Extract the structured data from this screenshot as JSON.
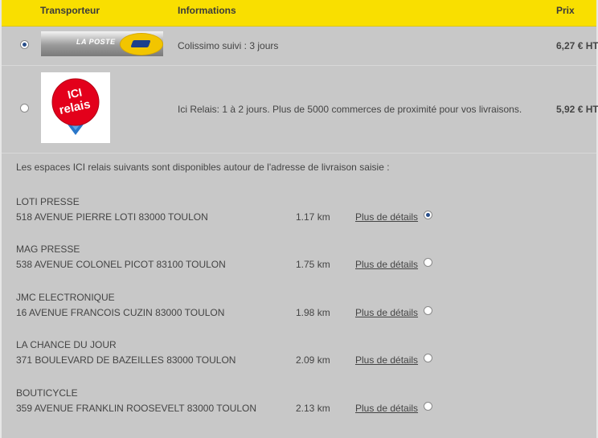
{
  "header": {
    "col_carrier": "Transporteur",
    "col_info": "Informations",
    "col_price": "Prix"
  },
  "carriers": [
    {
      "logo_text": "LA POSTE",
      "logo": "la-poste-logo",
      "info": "Colissimo suivi : 3 jours",
      "price": "6,27 € HT",
      "selected": true
    },
    {
      "logo_text": "ICI relais",
      "logo": "ici-relais-logo",
      "info": "Ici Relais: 1 à 2 jours. Plus de 5000 commerces de proximité pour vos livraisons.",
      "price": "5,92 € HT",
      "selected": false
    }
  ],
  "relais": {
    "intro": "Les espaces ICI relais suivants sont disponibles autour de l'adresse de livraison saisie :",
    "details_label": "Plus de détails",
    "items": [
      {
        "name": "LOTI PRESSE",
        "address": "518 AVENUE PIERRE LOTI 83000 TOULON",
        "distance": "1.17 km",
        "selected": true
      },
      {
        "name": "MAG PRESSE",
        "address": "538 AVENUE COLONEL PICOT 83100 TOULON",
        "distance": "1.75 km",
        "selected": false
      },
      {
        "name": "JMC ELECTRONIQUE",
        "address": "16 AVENUE FRANCOIS CUZIN 83000 TOULON",
        "distance": "1.98 km",
        "selected": false
      },
      {
        "name": "LA CHANCE DU JOUR",
        "address": "371 BOULEVARD DE BAZEILLES 83000 TOULON",
        "distance": "2.09 km",
        "selected": false
      },
      {
        "name": "BOUTICYCLE",
        "address": "359 AVENUE FRANKLIN ROOSEVELT 83000 TOULON",
        "distance": "2.13 km",
        "selected": false
      }
    ]
  },
  "colors": {
    "header_bg": "#f9df00",
    "page_bg": "#c8c8c8",
    "ici_red": "#e3001b",
    "ici_blue": "#2a76c9"
  }
}
